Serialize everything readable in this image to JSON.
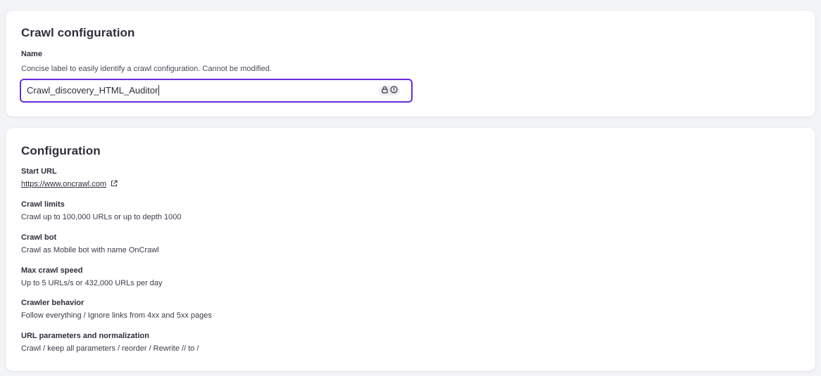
{
  "crawl_configuration_card": {
    "title": "Crawl configuration",
    "name_label": "Name",
    "name_help": "Concise label to easily identify a crawl configuration. Cannot be modified.",
    "name_value": "Crawl_discovery_HTML_Auditor",
    "icons": [
      "lock-icon",
      "info-icon"
    ]
  },
  "configuration_card": {
    "title": "Configuration",
    "items": [
      {
        "label": "Start URL",
        "value": "https://www.oncrawl.com",
        "icon": "external-link-icon"
      },
      {
        "label": "Crawl limits",
        "value": "Crawl up to 100,000 URLs or up to depth 1000"
      },
      {
        "label": "Crawl bot",
        "value": "Crawl as Mobile bot with name OnCrawl"
      },
      {
        "label": "Max crawl speed",
        "value": "Up to 5 URLs/s or 432,000 URLs per day"
      },
      {
        "label": "Crawler behavior",
        "value": "Follow everything / Ignore links from 4xx and 5xx pages"
      },
      {
        "label": "URL parameters and normalization",
        "value": "Crawl / keep all parameters / reorder / Rewrite // to /"
      }
    ]
  },
  "colors": {
    "accent": "#6b2bd9",
    "background": "#f3f4f7",
    "card": "#ffffff",
    "text": "#2e2e3e"
  }
}
